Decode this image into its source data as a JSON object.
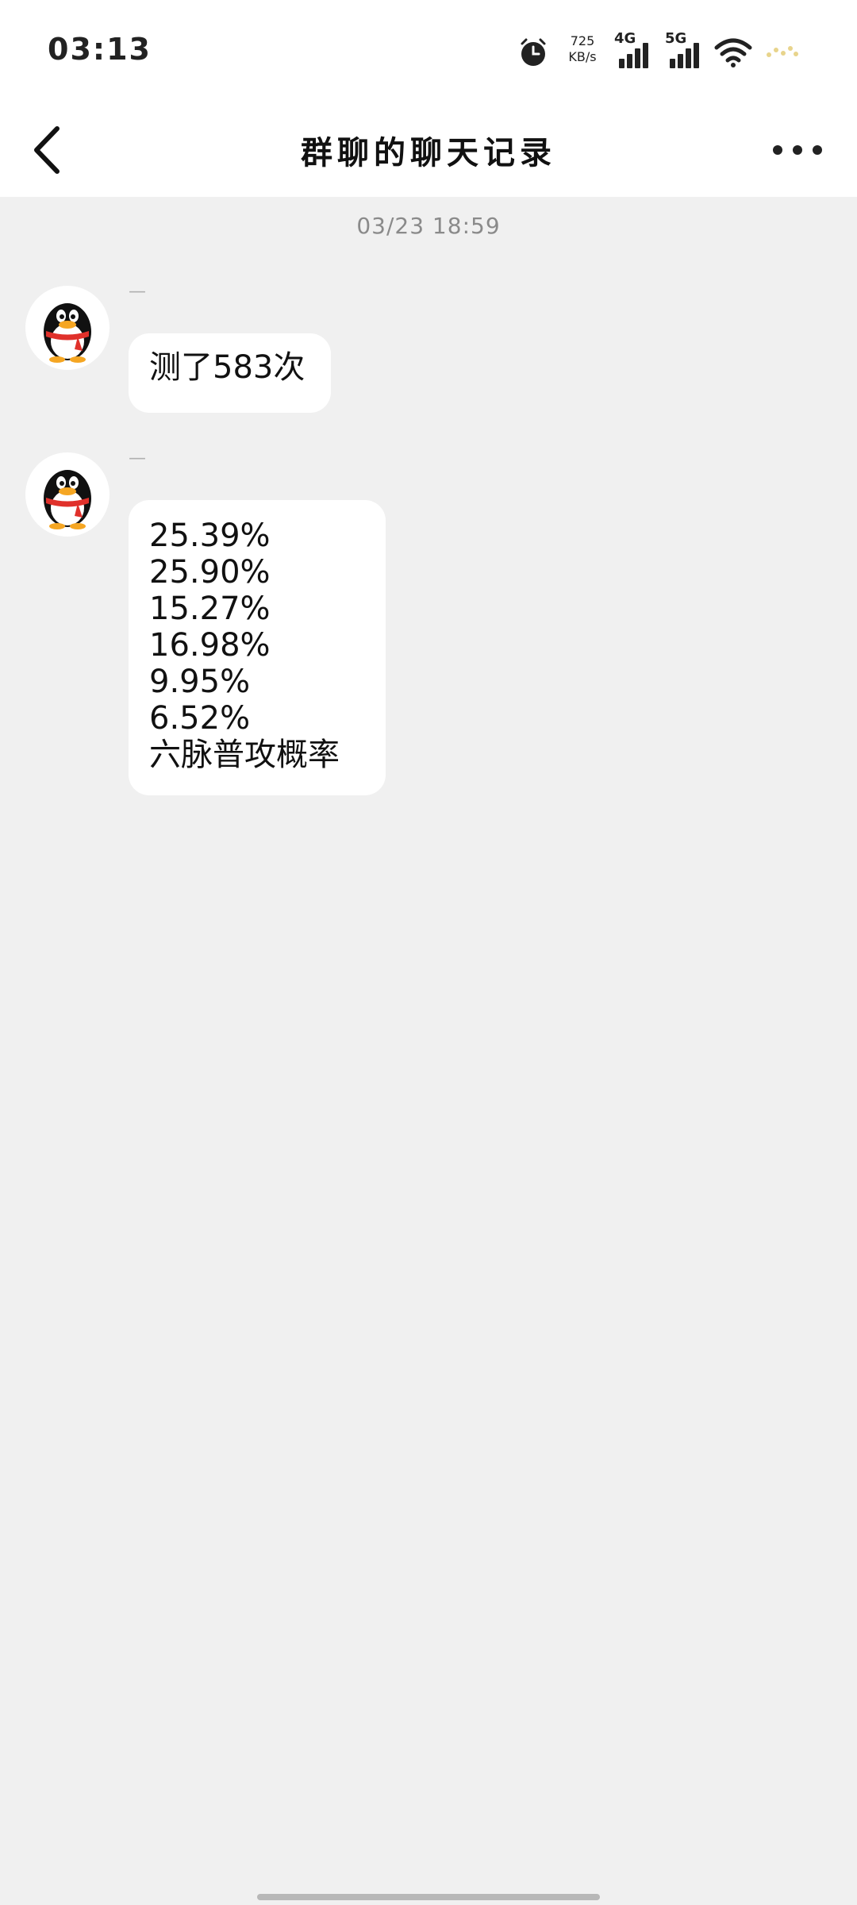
{
  "status_bar": {
    "time": "03:13",
    "net_speed_value": "725",
    "net_speed_unit": "KB/s",
    "network_1": "4G",
    "network_2": "5G",
    "icons": [
      "alarm-icon",
      "signal-icon",
      "signal-icon",
      "wifi-icon",
      "battery-icon"
    ]
  },
  "nav": {
    "title": "群聊的聊天记录",
    "back_icon": "chevron-left-icon",
    "more_icon": "more-horizontal-icon"
  },
  "chat": {
    "timestamp": "03/23 18:59",
    "messages": [
      {
        "sender_name": "—",
        "avatar": "penguin-avatar",
        "lines": [
          "测了583次"
        ]
      },
      {
        "sender_name": "—",
        "avatar": "penguin-avatar",
        "lines": [
          "25.39%",
          "25.90%",
          "15.27%",
          "16.98%",
          "9.95%",
          "6.52%",
          "六脉普攻概率"
        ]
      }
    ]
  },
  "colors": {
    "background": "#f0f0f0",
    "bubble": "#ffffff",
    "scarf_red": "#e0312b",
    "beak_yellow": "#f5a623"
  }
}
